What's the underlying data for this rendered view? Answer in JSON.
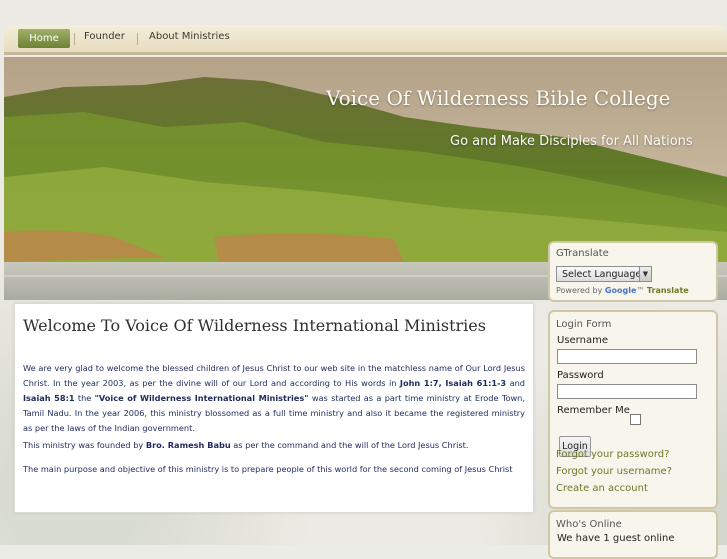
{
  "nav": {
    "items": [
      {
        "label": "Home",
        "active": true
      },
      {
        "label": "Founder",
        "active": false
      },
      {
        "label": "About Ministries",
        "active": false
      }
    ]
  },
  "header": {
    "site_title": "Voice Of Wilderness Bible College",
    "slogan": "Go and Make Disciples for All Nations"
  },
  "main": {
    "heading": "Welcome To Voice Of Wilderness International Ministries",
    "p1": {
      "a": "We are very glad to welcome the blessed children of Jesus Christ to our web site in the matchless name of Our Lord Jesus Christ. In the year 2003, as per the divine will of our Lord and according to His words in ",
      "b1": "John 1:7, Isaiah 61:1-3",
      "c": " and ",
      "b2": "Isaiah 58:1",
      "d": " the ",
      "b3": "\"Voice of Wilderness International Ministries\"",
      "e": " was started as a part time ministry at Erode Town, Tamil Nadu. In the year 2006, this ministry blossomed as a full time ministry and also it became the registered ministry as per the laws of the Indian government."
    },
    "p2": {
      "a": "This ministry was founded by ",
      "b": "Bro. Ramesh Babu",
      "c": " as per the command and the will of the Lord Jesus Christ."
    },
    "p3": "The main purpose and objective of this ministry is to prepare people of this world for the second coming of Jesus Christ"
  },
  "gtranslate": {
    "title": "GTranslate",
    "select_label": "Select Language",
    "powered_by": "Powered by",
    "google": "Google",
    "tm": "™",
    "translate": "Translate"
  },
  "login": {
    "title": "Login Form",
    "username_label": "Username",
    "password_label": "Password",
    "remember_label": "Remember Me",
    "login_button": "Login",
    "forgot_password": "Forgot your password?",
    "forgot_username": "Forgot your username?",
    "create_account": "Create an account"
  },
  "whos_online": {
    "title": "Who's Online",
    "text": "We have 1 guest online"
  },
  "colors": {
    "accent_green": "#6f8135",
    "link_green": "#6b7a2a",
    "body_text_blue": "#1f2a5c"
  }
}
